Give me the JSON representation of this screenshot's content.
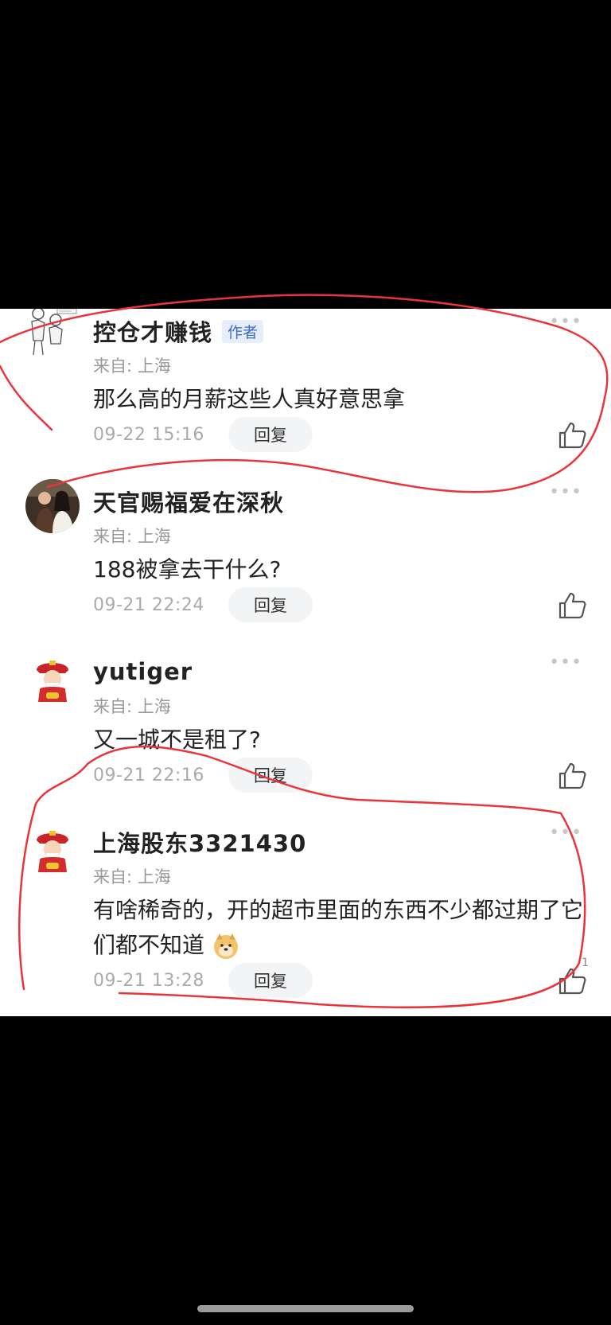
{
  "comments": [
    {
      "username": "控仓才赚钱",
      "badge": "作者",
      "location": "来自: 上海",
      "text": "那么高的月薪这些人真好意思拿",
      "timestamp": "09-22 15:16",
      "reply_label": "回复",
      "avatar_icon": "sketch-figures-avatar"
    },
    {
      "username": "天官赐福爱在深秋",
      "location": "来自: 上海",
      "text": "188被拿去干什么?",
      "timestamp": "09-21 22:24",
      "reply_label": "回复",
      "avatar_icon": "couple-photo-avatar"
    },
    {
      "username": "yutiger",
      "location": "来自: 上海",
      "text": "又一城不是租了?",
      "timestamp": "09-21 22:16",
      "reply_label": "回复",
      "avatar_icon": "god-of-wealth-avatar"
    },
    {
      "username": "上海股东3321430",
      "location": "来自: 上海",
      "text": "有啥稀奇的，开的超市里面的东西不少都过期了它们都不知道",
      "timestamp": "09-21 13:28",
      "reply_label": "回复",
      "like_count": "1",
      "avatar_icon": "god-of-wealth-avatar",
      "emoji_icon": "doge-emoji"
    }
  ],
  "colors": {
    "annotation": "#e8343a",
    "badge_text": "#3b6fc9",
    "meta_text": "#aaaaaa"
  }
}
